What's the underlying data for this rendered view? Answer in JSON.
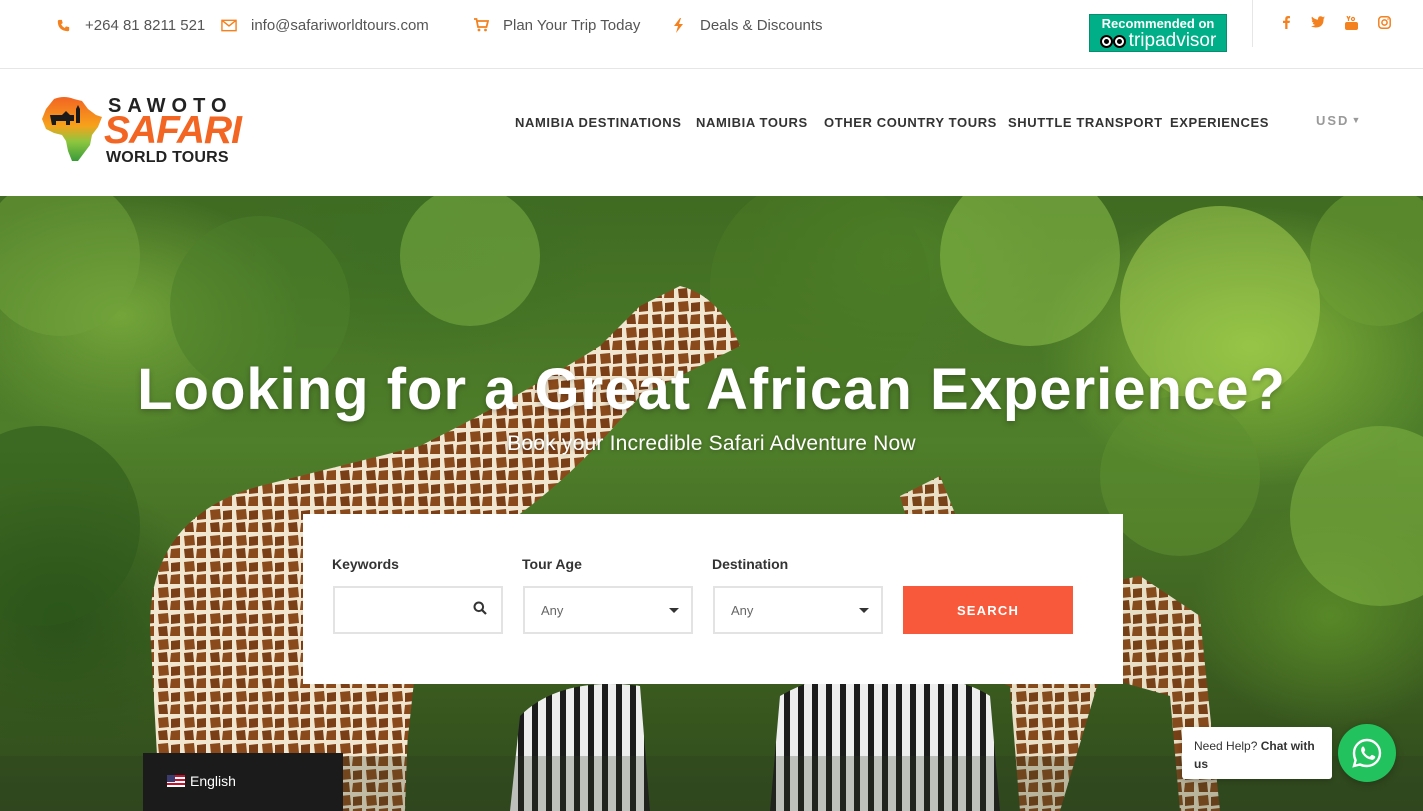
{
  "topbar": {
    "phone": {
      "icon": "phone-icon",
      "text": "+264 81 8211 521"
    },
    "email": {
      "icon": "envelope-icon",
      "text": "info@safariworldtours.com"
    },
    "plan": {
      "icon": "cart-icon",
      "text": "Plan Your Trip Today"
    },
    "deals": {
      "icon": "bolt-icon",
      "text": "Deals & Discounts"
    },
    "tripadvisor": {
      "line1": "Recommended on",
      "line2": "tripadvisor"
    },
    "social": [
      {
        "name": "facebook-icon",
        "glyph": "f"
      },
      {
        "name": "twitter-icon",
        "glyph": "t"
      },
      {
        "name": "youtube-icon",
        "glyph": "You"
      },
      {
        "name": "instagram-icon",
        "glyph": "◎"
      }
    ]
  },
  "header": {
    "logo": {
      "line1": "SAWOTO",
      "line2": "SAFARI",
      "line3": "WORLD TOURS"
    },
    "nav": [
      {
        "label": "NAMIBIA DESTINATIONS"
      },
      {
        "label": "NAMIBIA TOURS"
      },
      {
        "label": "OTHER COUNTRY TOURS"
      },
      {
        "label": "SHUTTLE TRANSPORT"
      },
      {
        "label": "EXPERIENCES"
      }
    ],
    "currency": "USD"
  },
  "hero": {
    "title": "Looking for a Great African Experience?",
    "subtitle": "Book your Incredible Safari Adventure Now"
  },
  "search": {
    "keywords_label": "Keywords",
    "keywords_value": "",
    "tour_age_label": "Tour Age",
    "tour_age_value": "Any",
    "destination_label": "Destination",
    "destination_value": "Any",
    "button": "SEARCH"
  },
  "language": {
    "label": "English"
  },
  "chat": {
    "prefix": "Need Help?",
    "bold": "Chat with us"
  },
  "colors": {
    "accent": "#f4811f",
    "search_button": "#f8593b",
    "whatsapp": "#22c35e",
    "tripadvisor": "#00af87"
  }
}
